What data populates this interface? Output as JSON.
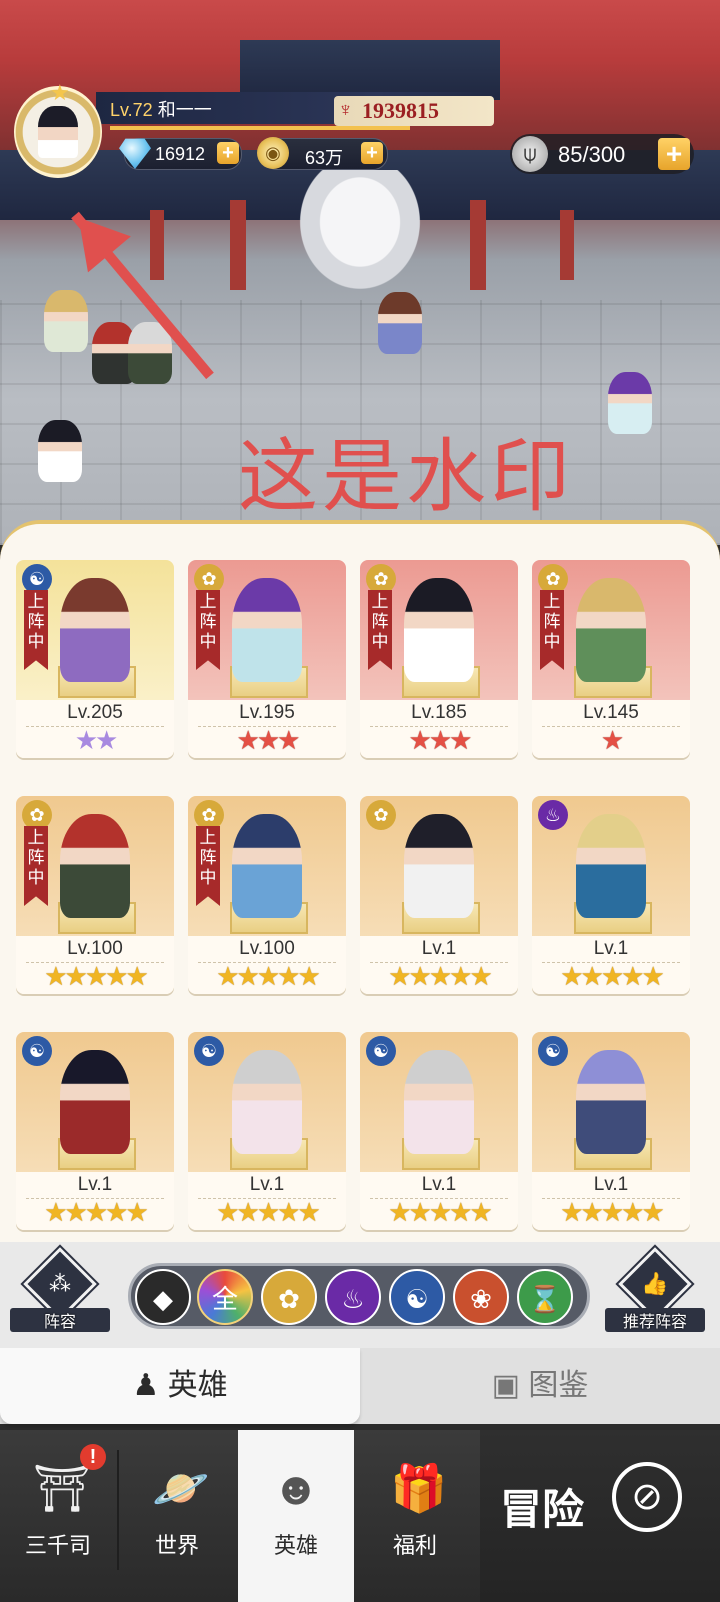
{
  "player": {
    "level_prefix": "Lv.72",
    "name": "和一一",
    "power": "1939815",
    "gems": "16912",
    "gold": "63万",
    "stamina": "85/300"
  },
  "watermark": "这是水印",
  "heroes": [
    {
      "level": "Lv.205",
      "stars": "★★",
      "deployed": "上\n阵\n中",
      "badge": "☯",
      "theme": "gold"
    },
    {
      "level": "Lv.195",
      "stars": "★★★",
      "deployed": "上\n阵\n中",
      "badge": "✿",
      "theme": "red"
    },
    {
      "level": "Lv.185",
      "stars": "★★★",
      "deployed": "上\n阵\n中",
      "badge": "✿",
      "theme": "red"
    },
    {
      "level": "Lv.145",
      "stars": "★",
      "deployed": "上\n阵\n中",
      "badge": "✿",
      "theme": "red"
    },
    {
      "level": "Lv.100",
      "stars": "★★★★★",
      "deployed": "上\n阵\n中",
      "badge": "✿",
      "theme": "orange"
    },
    {
      "level": "Lv.100",
      "stars": "★★★★★",
      "deployed": "上\n阵\n中",
      "badge": "✿",
      "theme": "orange"
    },
    {
      "level": "Lv.1",
      "stars": "★★★★★",
      "deployed": "",
      "badge": "✿",
      "theme": "orange"
    },
    {
      "level": "Lv.1",
      "stars": "★★★★★",
      "deployed": "",
      "badge": "♨",
      "theme": "orange"
    },
    {
      "level": "Lv.1",
      "stars": "★★★★★",
      "deployed": "",
      "badge": "☯",
      "theme": "orange"
    },
    {
      "level": "Lv.1",
      "stars": "★★★★★",
      "deployed": "",
      "badge": "☯",
      "theme": "orange"
    },
    {
      "level": "Lv.1",
      "stars": "★★★★★",
      "deployed": "",
      "badge": "☯",
      "theme": "orange"
    },
    {
      "level": "Lv.1",
      "stars": "★★★★★",
      "deployed": "",
      "badge": "☯",
      "theme": "orange"
    }
  ],
  "filters": {
    "lineup": "阵容",
    "all": "全",
    "recommend": "推荐阵容"
  },
  "tabs": {
    "heroes": "英雄",
    "atlas": "图鉴"
  },
  "nav": {
    "sanqian": "三千司",
    "world": "世界",
    "heroes": "英雄",
    "welfare": "福利",
    "adventure": "冒险",
    "alert": "!"
  },
  "colors": {
    "accent_gold": "#f0b523",
    "deployed_red": "#a72a2a",
    "power_red": "#9b1f22"
  }
}
